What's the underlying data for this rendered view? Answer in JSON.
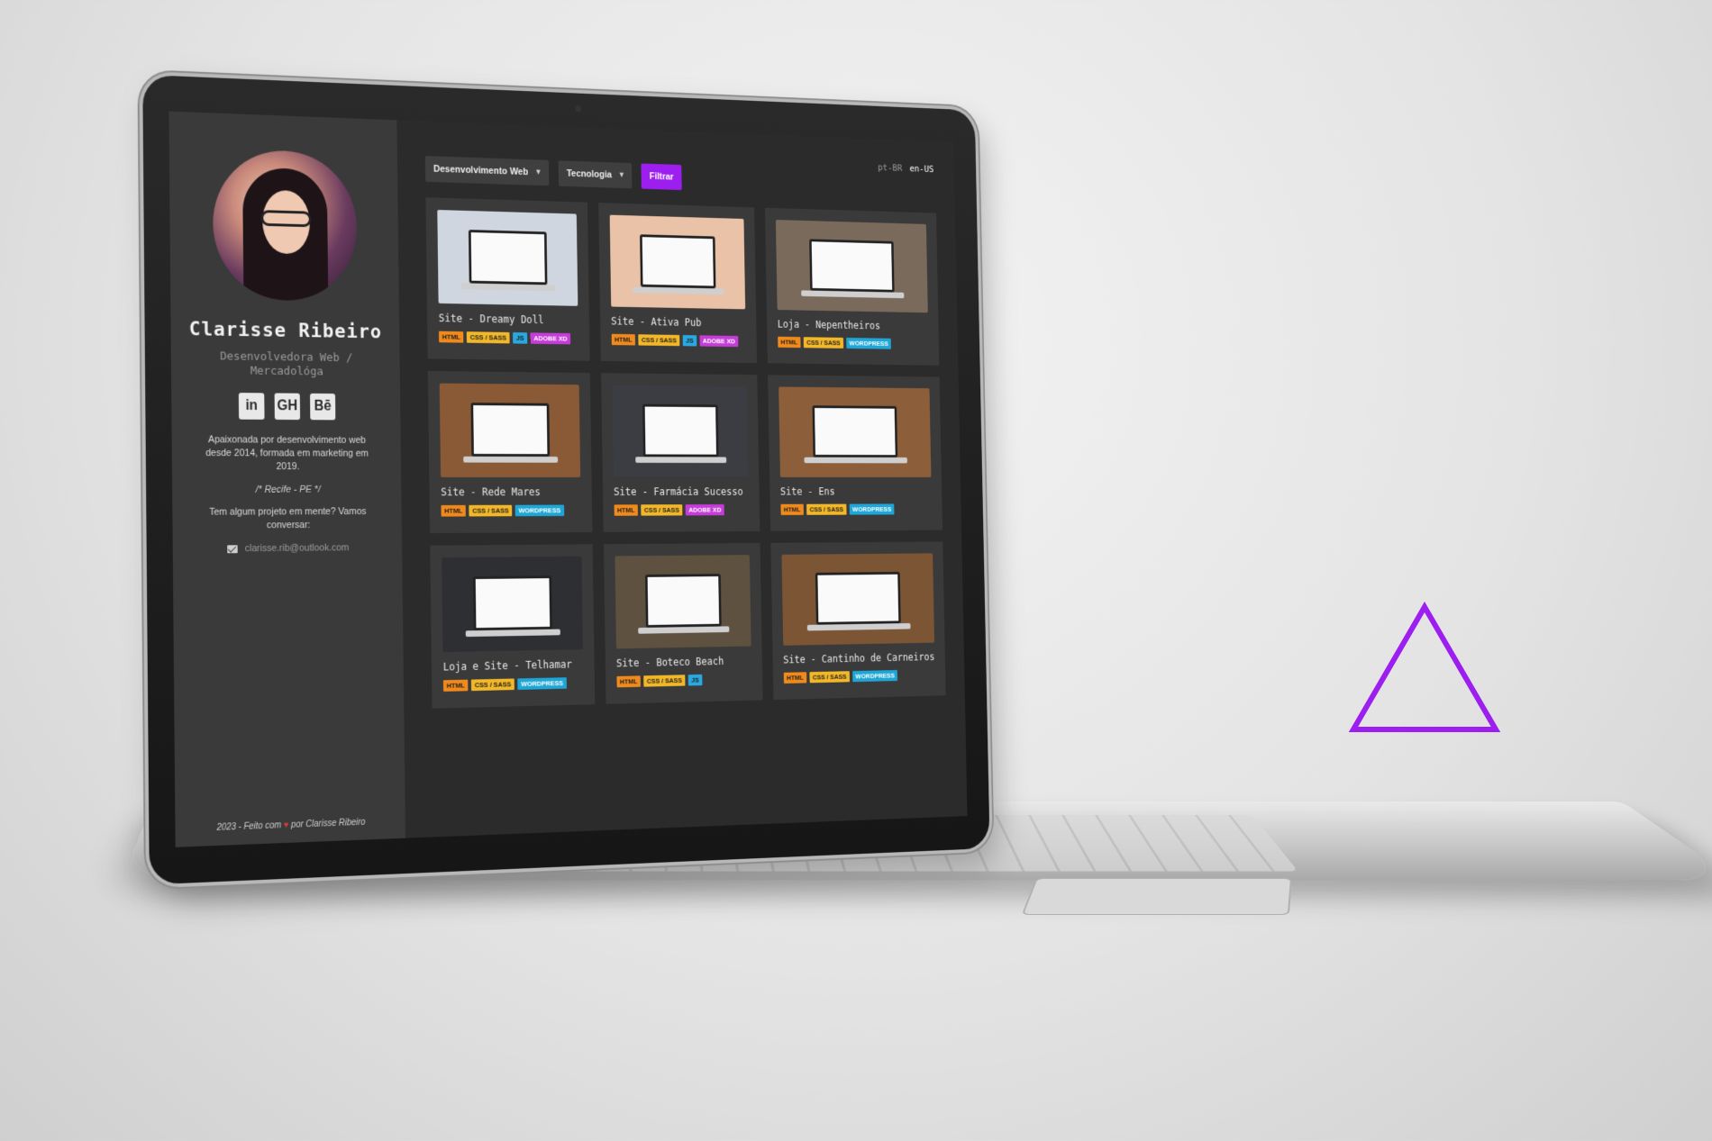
{
  "profile": {
    "name": "Clarisse Ribeiro",
    "role": "Desenvolvedora Web / Mercadológa",
    "bio": "Apaixonada por desenvolvimento web desde 2014, formada em marketing em 2019.",
    "location": "/* Recife - PE */",
    "cta": "Tem algum projeto em mente? Vamos conversar:",
    "email": "clarisse.rib@outlook.com"
  },
  "socials": [
    {
      "label": "in",
      "icon": "linkedin-icon"
    },
    {
      "label": "GH",
      "icon": "github-icon"
    },
    {
      "label": "Bē",
      "icon": "behance-icon"
    }
  ],
  "footer": {
    "prefix": "2023 - Feito com",
    "suffix": "por Clarisse Ribeiro"
  },
  "filters": {
    "category": "Desenvolvimento Web",
    "technology": "Tecnologia",
    "button": "Filtrar"
  },
  "languages": {
    "pt": "pt-BR",
    "en": "en-US"
  },
  "projects": [
    {
      "title": "Site - Dreamy Doll",
      "tags": [
        "HTML",
        "CSS / SASS",
        "JS",
        "ADOBE XD"
      ],
      "bg": "#cfd6df"
    },
    {
      "title": "Site - Ativa Pub",
      "tags": [
        "HTML",
        "CSS / SASS",
        "JS",
        "ADOBE XD"
      ],
      "bg": "#e9c2a8"
    },
    {
      "title": "Loja - Nepentheiros",
      "tags": [
        "HTML",
        "CSS / SASS",
        "WORDPRESS"
      ],
      "bg": "#7a6a5c"
    },
    {
      "title": "Site - Rede Mares",
      "tags": [
        "HTML",
        "CSS / SASS",
        "WORDPRESS"
      ],
      "bg": "#8a5a36"
    },
    {
      "title": "Site - Farmácia Sucesso",
      "tags": [
        "HTML",
        "CSS / SASS",
        "ADOBE XD"
      ],
      "bg": "#3b3d42"
    },
    {
      "title": "Site - Ens",
      "tags": [
        "HTML",
        "CSS / SASS",
        "WORDPRESS"
      ],
      "bg": "#8c5e3a"
    },
    {
      "title": "Loja e Site - Telhamar",
      "tags": [
        "HTML",
        "CSS / SASS",
        "WORDPRESS"
      ],
      "bg": "#2d2f33"
    },
    {
      "title": "Site - Boteco Beach",
      "tags": [
        "HTML",
        "CSS / SASS",
        "JS"
      ],
      "bg": "#5e5140"
    },
    {
      "title": "Site - Cantinho de Carneiros",
      "tags": [
        "HTML",
        "CSS / SASS",
        "WORDPRESS"
      ],
      "bg": "#7b5534"
    }
  ],
  "colors": {
    "accent": "#9c1ff0",
    "sidebar": "#3a3a3a",
    "main": "#2b2b2b"
  }
}
